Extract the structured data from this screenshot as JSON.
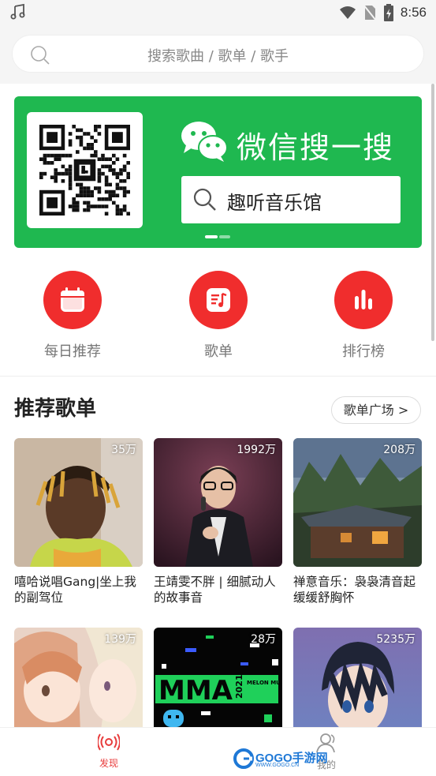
{
  "status_bar": {
    "time": "8:56"
  },
  "search": {
    "placeholder": "搜索歌曲 / 歌单 / 歌手"
  },
  "banner": {
    "title": "微信搜一搜",
    "search_text": "趣听音乐馆",
    "accent": "#1fb850"
  },
  "entries": [
    {
      "label": "每日推荐",
      "icon": "calendar-icon"
    },
    {
      "label": "歌单",
      "icon": "playlist-icon"
    },
    {
      "label": "排行榜",
      "icon": "chart-bars-icon"
    }
  ],
  "section": {
    "title": "推荐歌单",
    "more": "歌单广场 >"
  },
  "playlists": [
    {
      "count": "35万",
      "title": "嘻哈说唱Gang|坐上我的副驾位"
    },
    {
      "count": "1992万",
      "title": "王靖雯不胖 | 细腻动人的故事音"
    },
    {
      "count": "208万",
      "title": "禅意音乐：袅袅清音起缓缓舒胸怀"
    },
    {
      "count": "139万",
      "title": ""
    },
    {
      "count": "28万",
      "title": ""
    },
    {
      "count": "5235万",
      "title": ""
    }
  ],
  "cover_texts": {
    "mma": "MMA",
    "mma_year": "2021",
    "mma_sub": "MELON MUSIC AWARDS"
  },
  "bottom_nav": {
    "discover": "发现",
    "mine": "我的"
  },
  "watermark": {
    "brand": "GOGO手游网",
    "url": "WWW.GOGO.CN"
  },
  "colors": {
    "primary_red": "#f02d2d",
    "nav_active": "#e83c3c"
  }
}
